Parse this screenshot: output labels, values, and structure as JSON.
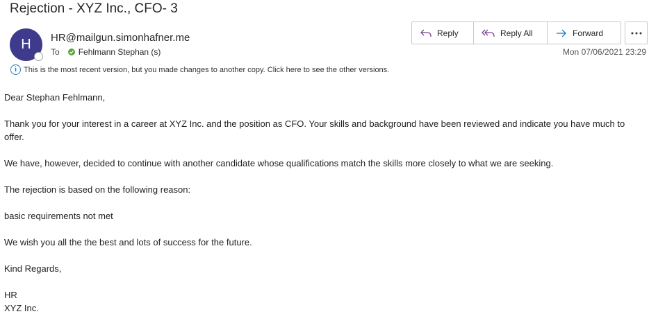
{
  "email": {
    "subject": "Rejection - XYZ Inc., CFO- 3",
    "avatar_initial": "H",
    "sender": "HR@mailgun.simonhafner.me",
    "to_label": "To",
    "recipient": "Fehlmann Stephan (s)",
    "datetime": "Mon 07/06/2021 23:29",
    "info_banner": "This is the most recent version, but you made changes to another copy. Click here to see the other versions."
  },
  "actions": {
    "reply": "Reply",
    "reply_all": "Reply All",
    "forward": "Forward",
    "more": "..."
  },
  "body": {
    "greeting": "Dear Stephan Fehlmann,",
    "para1": "Thank you for your interest in a career at XYZ Inc. and the position as CFO. Your skills and background have been reviewed and indicate you have much to offer.",
    "para2": "We have, however, decided to continue with another candidate whose qualifications match the skills more closely to what we are seeking.",
    "para3": "The rejection is based on the following reason:",
    "reason": "basic requirements not met",
    "para4": "We wish you all the the best and lots of success for the future.",
    "closing": "Kind Regards,",
    "sig_name": "HR",
    "sig_company": "XYZ Inc."
  },
  "colors": {
    "avatar_bg": "#3e3a8c",
    "reply_icon": "#7a3f8f",
    "forward_icon": "#2a7ab8",
    "presence_ok": "#5aa63a",
    "info_icon": "#2a7ab8"
  },
  "icons": {
    "reply": "reply-arrow-icon",
    "reply_all": "reply-all-arrow-icon",
    "forward": "forward-arrow-icon",
    "more": "more-options-icon",
    "info": "info-icon",
    "presence": "presence-status-icon",
    "recipient_status": "checkmark-icon"
  }
}
